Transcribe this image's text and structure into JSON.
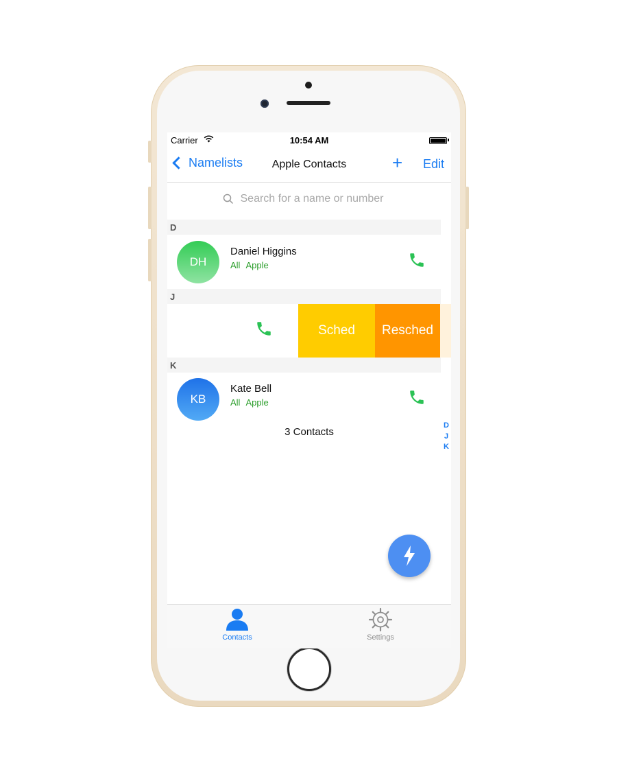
{
  "status_bar": {
    "carrier": "Carrier",
    "time": "10:54 AM"
  },
  "nav": {
    "back_label": "Namelists",
    "title": "Apple Contacts",
    "add_label": "+",
    "edit_label": "Edit"
  },
  "search": {
    "placeholder": "Search for a name or number"
  },
  "sections": [
    {
      "letter": "D",
      "contacts": [
        {
          "initials": "DH",
          "name": "Daniel Higgins",
          "tags": [
            "All",
            "Apple"
          ]
        }
      ]
    },
    {
      "letter": "J",
      "swipe_actions": [
        "Sched",
        "Resched"
      ]
    },
    {
      "letter": "K",
      "contacts": [
        {
          "initials": "KB",
          "name": "Kate Bell",
          "tags": [
            "All",
            "Apple"
          ]
        }
      ]
    }
  ],
  "contact_count": "3 Contacts",
  "index": [
    "D",
    "J",
    "K"
  ],
  "tabs": [
    {
      "label": "Contacts",
      "icon": "person-icon",
      "active": true
    },
    {
      "label": "Settings",
      "icon": "gear-icon",
      "active": false
    }
  ],
  "fab": {
    "icon": "lightning-bolt-icon"
  },
  "colors": {
    "accent": "#1a7cf2",
    "call_green": "#2bc255",
    "tag_green": "#2a9d2a",
    "sched_yellow": "#ffcc00",
    "resched_orange": "#ff9500",
    "fab_blue": "#4d8ff2"
  }
}
